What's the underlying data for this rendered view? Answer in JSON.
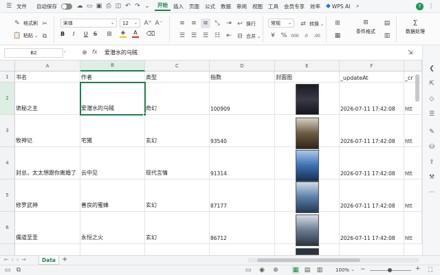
{
  "menubar": {
    "file": "文件",
    "autosave": "自动保存",
    "tabs": [
      "开始",
      "插入",
      "页面",
      "公式",
      "数据",
      "审阅",
      "视图",
      "工具",
      "会员专享",
      "效率"
    ],
    "wps_ai": "WPS AI"
  },
  "ribbon": {
    "format_painter": "格式刷",
    "paste": "粘贴",
    "font_name": "宋体",
    "font_size": "12",
    "wrap": "换行",
    "merge": "合并",
    "number_format": "常规",
    "convert": "转换",
    "conditional_format": "条件格式",
    "data_process": "数据处理",
    "bold": "B",
    "italic": "I",
    "underline": "U"
  },
  "formula_bar": {
    "cell_ref": "B2",
    "fx": "fx",
    "value": "爱潜水的乌贼"
  },
  "grid": {
    "columns": [
      "A",
      "B",
      "C",
      "D",
      "E",
      "F"
    ],
    "rows": [
      "1",
      "2",
      "3",
      "4",
      "5",
      "6"
    ],
    "header": [
      "书名",
      "作者",
      "类型",
      "指数",
      "封面图",
      "_updateAt",
      "_cr"
    ],
    "data": [
      {
        "title": "诡秘之主",
        "author": "爱潜水的乌贼",
        "type": "奇幻",
        "index": "100909",
        "updated": "2026-07-11 17:42:08",
        "more": "htt"
      },
      {
        "title": "牧神记",
        "author": "宅猪",
        "type": "玄幻",
        "index": "93540",
        "updated": "2026-07-11 17:42:08",
        "more": "htt"
      },
      {
        "title": "封总，太太想跟你离婚了",
        "author": "云中见",
        "type": "现代言情",
        "index": "91314",
        "updated": "2026-07-11 17:42:08",
        "more": "htt"
      },
      {
        "title": "修罗武神",
        "author": "善良的蜜蜂",
        "type": "玄幻",
        "index": "87177",
        "updated": "2026-07-11 17:42:08",
        "more": "htt"
      },
      {
        "title": "儒道至圣",
        "author": "永恒之火",
        "type": "玄幻",
        "index": "86712",
        "updated": "2026-07-11 17:42:08",
        "more": "htt"
      }
    ]
  },
  "cover_colors": [
    "#2a2a33",
    "#5b4a3a",
    "#3b6fb0",
    "#5a7ea8",
    "#6a7c90"
  ],
  "sheet_tab": "Data",
  "status": {
    "zoom": "100%"
  }
}
